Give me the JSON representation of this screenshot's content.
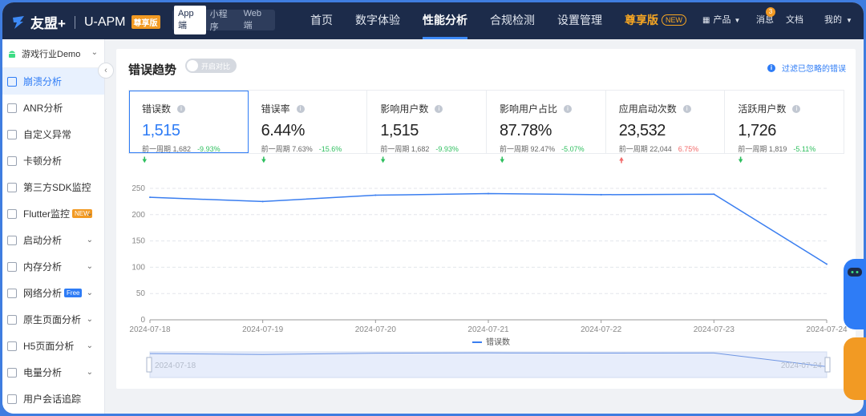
{
  "header": {
    "brand": "友盟+",
    "product": "U-APM",
    "edition_badge": "尊享版",
    "segments": [
      "App端",
      "小程序",
      "Web端"
    ],
    "active_segment": 0,
    "nav": [
      "首页",
      "数字体验",
      "性能分析",
      "合规检测",
      "设置管理"
    ],
    "active_nav": 2,
    "vip_label": "尊享版",
    "vip_tag": "NEW",
    "products_label": "产品",
    "messages_label": "消息",
    "messages_count": "3",
    "docs_label": "文档",
    "account_label": "我的"
  },
  "sidebar": {
    "app_name": "游戏行业Demo",
    "items": [
      {
        "label": "崩溃分析",
        "active": true
      },
      {
        "label": "ANR分析"
      },
      {
        "label": "自定义异常"
      },
      {
        "label": "卡顿分析"
      },
      {
        "label": "第三方SDK监控"
      },
      {
        "label": "Flutter监控",
        "tag": "NEW",
        "expand": true
      },
      {
        "label": "启动分析",
        "expand": true
      },
      {
        "label": "内存分析",
        "expand": true
      },
      {
        "label": "网络分析",
        "tag": "Free",
        "expand": true
      },
      {
        "label": "原生页面分析",
        "expand": true
      },
      {
        "label": "H5页面分析",
        "expand": true
      },
      {
        "label": "电量分析",
        "expand": true
      },
      {
        "label": "用户会话追踪"
      }
    ]
  },
  "main": {
    "title": "错误趋势",
    "compare_toggle_label": "开启对比",
    "filter_link": "过滤已忽略的错误",
    "metrics": [
      {
        "label": "错误数",
        "value": "1,515",
        "prev_label": "前一周期",
        "prev_value": "1,682",
        "change": "-9.93%",
        "direction": "down"
      },
      {
        "label": "错误率",
        "value": "6.44%",
        "prev_label": "前一周期",
        "prev_value": "7.63%",
        "change": "-15.6%",
        "direction": "down"
      },
      {
        "label": "影响用户数",
        "value": "1,515",
        "prev_label": "前一周期",
        "prev_value": "1,682",
        "change": "-9.93%",
        "direction": "down"
      },
      {
        "label": "影响用户占比",
        "value": "87.78%",
        "prev_label": "前一周期",
        "prev_value": "92.47%",
        "change": "-5.07%",
        "direction": "down"
      },
      {
        "label": "应用启动次数",
        "value": "23,532",
        "prev_label": "前一周期",
        "prev_value": "22,044",
        "change": "6.75%",
        "direction": "up"
      },
      {
        "label": "活跃用户数",
        "value": "1,726",
        "prev_label": "前一周期",
        "prev_value": "1,819",
        "change": "-5.11%",
        "direction": "down"
      }
    ]
  },
  "colors": {
    "accent": "#2e7cf6",
    "down": "#2fbf5f",
    "up": "#f26a6a",
    "topbar": "#1c2b4a"
  },
  "chart_data": {
    "type": "line",
    "x": [
      "2024-07-18",
      "2024-07-19",
      "2024-07-20",
      "2024-07-21",
      "2024-07-22",
      "2024-07-23",
      "2024-07-24"
    ],
    "series": [
      {
        "name": "错误数",
        "values": [
          233,
          225,
          237,
          240,
          238,
          239,
          106
        ]
      }
    ],
    "yticks": [
      0,
      50,
      100,
      150,
      200,
      250
    ],
    "ylim": [
      0,
      250
    ],
    "grid": true,
    "legend": "bottom",
    "slider": {
      "start_label": "2024-07-18",
      "end_label": "2024-07-24"
    }
  }
}
